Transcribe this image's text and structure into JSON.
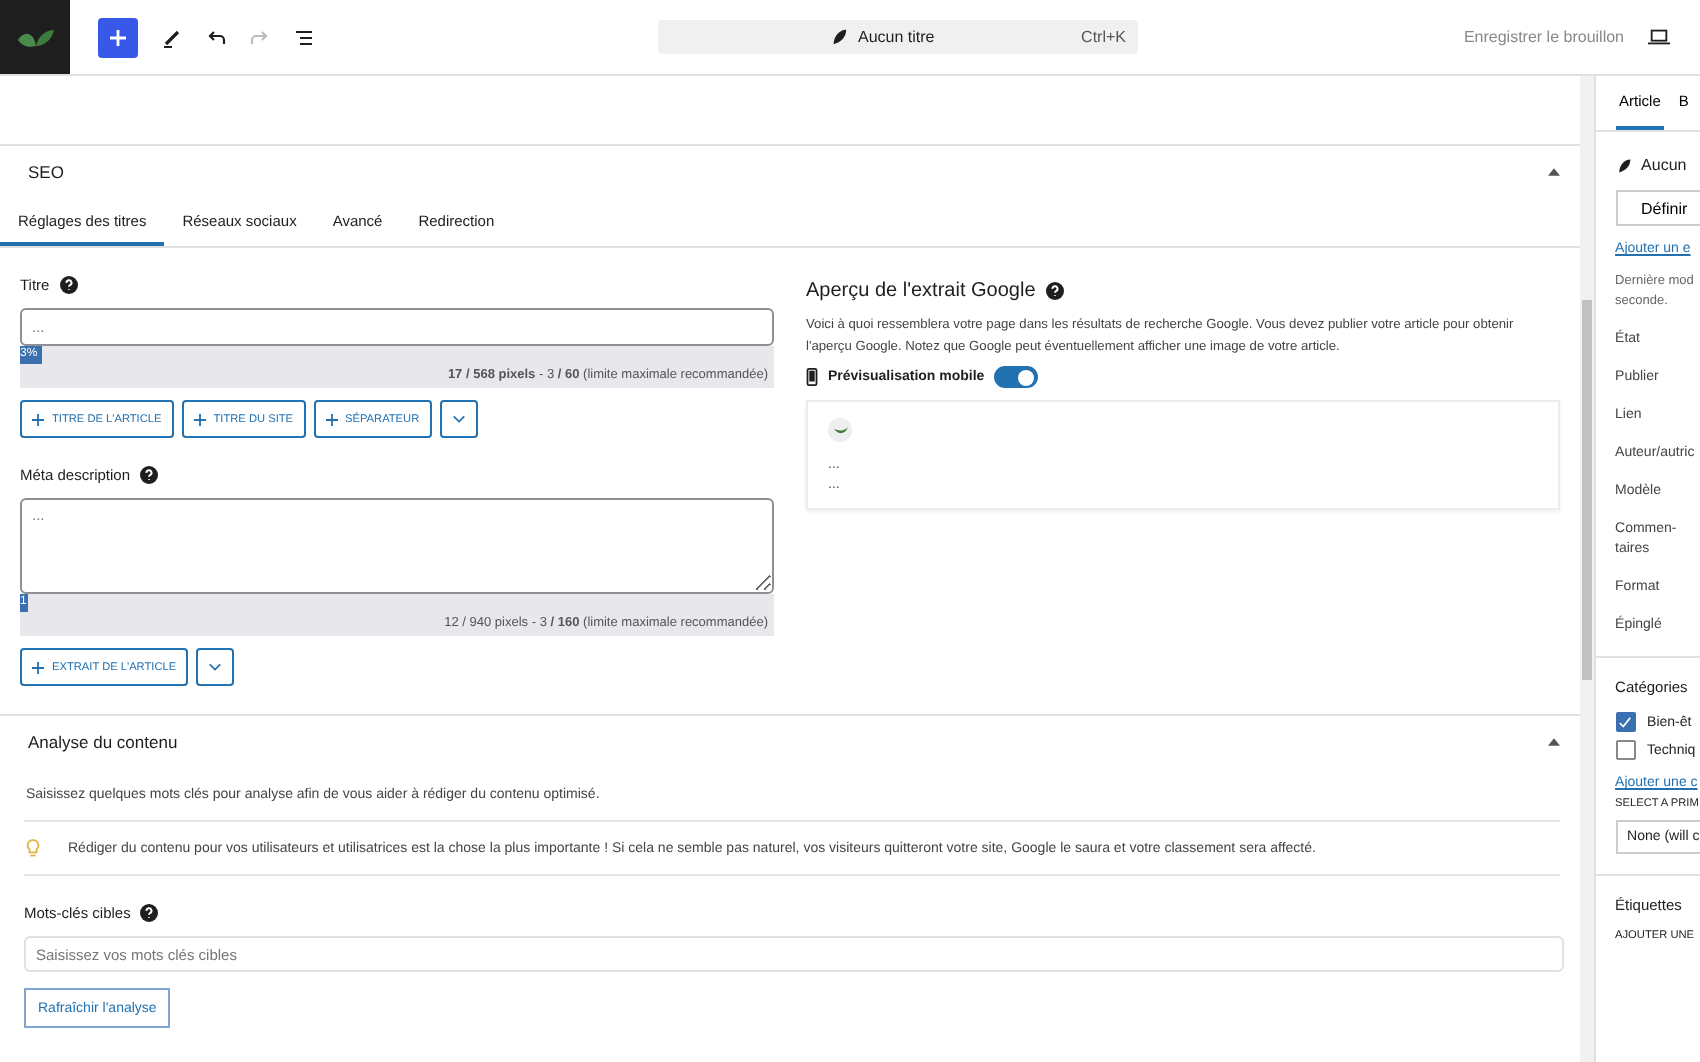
{
  "toolbar": {
    "search_title": "Aucun titre",
    "shortcut": "Ctrl+K",
    "save_draft": "Enregistrer le brouillon"
  },
  "seo_panel": {
    "title": "SEO",
    "expanded": true,
    "tabs": [
      {
        "label": "Réglages des titres",
        "selected": true
      },
      {
        "label": "Réseaux sociaux",
        "selected": false
      },
      {
        "label": "Avancé",
        "selected": false
      },
      {
        "label": "Redirection",
        "selected": false
      }
    ],
    "title_field": {
      "label": "Titre",
      "placeholder": "...",
      "progress": {
        "label": "3%",
        "level": 0.03
      },
      "counter": "**17 / 568 pixels** - 3 **/ 60** (limite maximale recommandée)",
      "buttons": [
        {
          "kind": "add",
          "label": "TITRE DE L'ARTICLE"
        },
        {
          "kind": "add",
          "label": "TITRE DU SITE"
        },
        {
          "kind": "add",
          "label": "SÉPARATEUR"
        },
        {
          "kind": "more"
        }
      ]
    },
    "meta_field": {
      "label": "Méta description",
      "placeholder": "...",
      "progress": {
        "label": "1",
        "level": 0.01
      },
      "counter": "12 / 940 pixels - 3 **/ 160** (limite maximale recommandée)",
      "buttons": [
        {
          "kind": "add",
          "label": "EXTRAIT DE L'ARTICLE"
        },
        {
          "kind": "more"
        }
      ]
    },
    "google_preview": {
      "title": "Aperçu de l'extrait Google",
      "description": "Voici à quoi ressemblera votre page dans les résultats de recherche Google. Vous devez publier votre article pour obtenir l'aperçu Google. Notez que Google peut éventuellement afficher une image de votre article.",
      "mobile_toggle": {
        "label": "Prévisualisation mobile",
        "on": true
      },
      "snippet_lines": [
        "...",
        "..."
      ]
    }
  },
  "content_analysis": {
    "title": "Analyse du contenu",
    "expanded": true,
    "intro": "Saisissez quelques mots clés pour analyse afin de vous aider à rédiger du contenu optimisé.",
    "tip": "Rédiger du contenu pour vos utilisateurs et utilisatrices est la chose la plus importante ! Si cela ne semble pas naturel, vos visiteurs quitteront votre site, Google le saura et votre classement sera affecté.",
    "keywords": {
      "label": "Mots-clés cibles",
      "placeholder": "Saisissez vos mots clés cibles"
    },
    "refresh_button": "Rafraîchir l'analyse"
  },
  "sidebar": {
    "tabs": [
      {
        "label": "Article",
        "selected": true
      },
      {
        "label": "B",
        "selected": false
      }
    ],
    "post_title": "Aucun",
    "set_button": "Définir",
    "add_link": "Ajouter un e",
    "last_modified": "Dernière mod seconde.",
    "fields": [
      "État",
      "Publier",
      "Lien",
      "Auteur/autric",
      "Modèle",
      "Commen-taires",
      "Format",
      "Épinglé"
    ],
    "categories": {
      "title": "Catégories",
      "items": [
        {
          "label": "Bien-êt",
          "checked": true
        },
        {
          "label": "Techniq",
          "checked": false
        }
      ],
      "add_link": "Ajouter une c",
      "primary_label": "SELECT A PRIM",
      "primary_select": "None (will c"
    },
    "tags": {
      "title": "Étiquettes",
      "add_label": "AJOUTER UNE"
    }
  }
}
